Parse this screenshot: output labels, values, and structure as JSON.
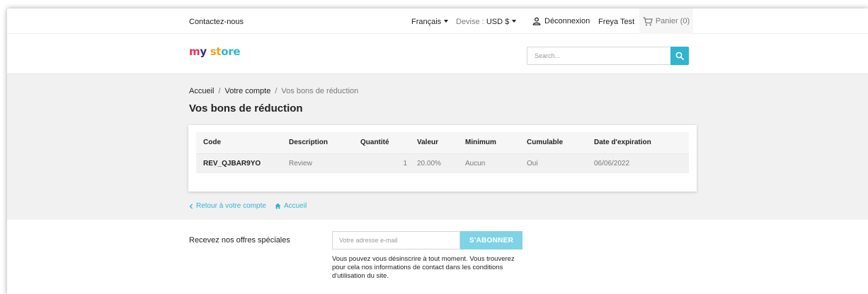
{
  "topnav": {
    "contact": "Contactez-nous",
    "language": "Français",
    "currency_label": "Devise :",
    "currency_value": "USD $",
    "logout": "Déconnexion",
    "user": "Freya Test",
    "cart": "Panier (0)"
  },
  "header": {
    "logo_parts": [
      "m",
      "y",
      " st",
      "ore"
    ],
    "search_placeholder": "Search..."
  },
  "breadcrumb": {
    "home": "Accueil",
    "account": "Votre compte",
    "current": "Vos bons de réduction"
  },
  "page_title": "Vos bons de réduction",
  "table": {
    "headers": [
      "Code",
      "Description",
      "Quantité",
      "Valeur",
      "Minimum",
      "Cumulable",
      "Date d'expiration"
    ],
    "rows": [
      [
        "REV_QJBAR9YO",
        "Review",
        "1",
        "20.00%",
        "Aucun",
        "Oui",
        "06/06/2022"
      ]
    ]
  },
  "links": {
    "back": "Retour à votre compte",
    "home": "Accueil"
  },
  "newsletter": {
    "label": "Recevez nos offres spéciales",
    "placeholder": "Votre adresse e-mail",
    "button": "S'ABONNER",
    "note": "Vous pouvez vous désinscrire à tout moment. Vous trouverez pour cela nos informations de contact dans les conditions d'utilisation du site."
  },
  "colors": {
    "accent": "#2fb5d2",
    "button_light": "#7fd3e6",
    "background_gray": "#f1f1f1"
  }
}
